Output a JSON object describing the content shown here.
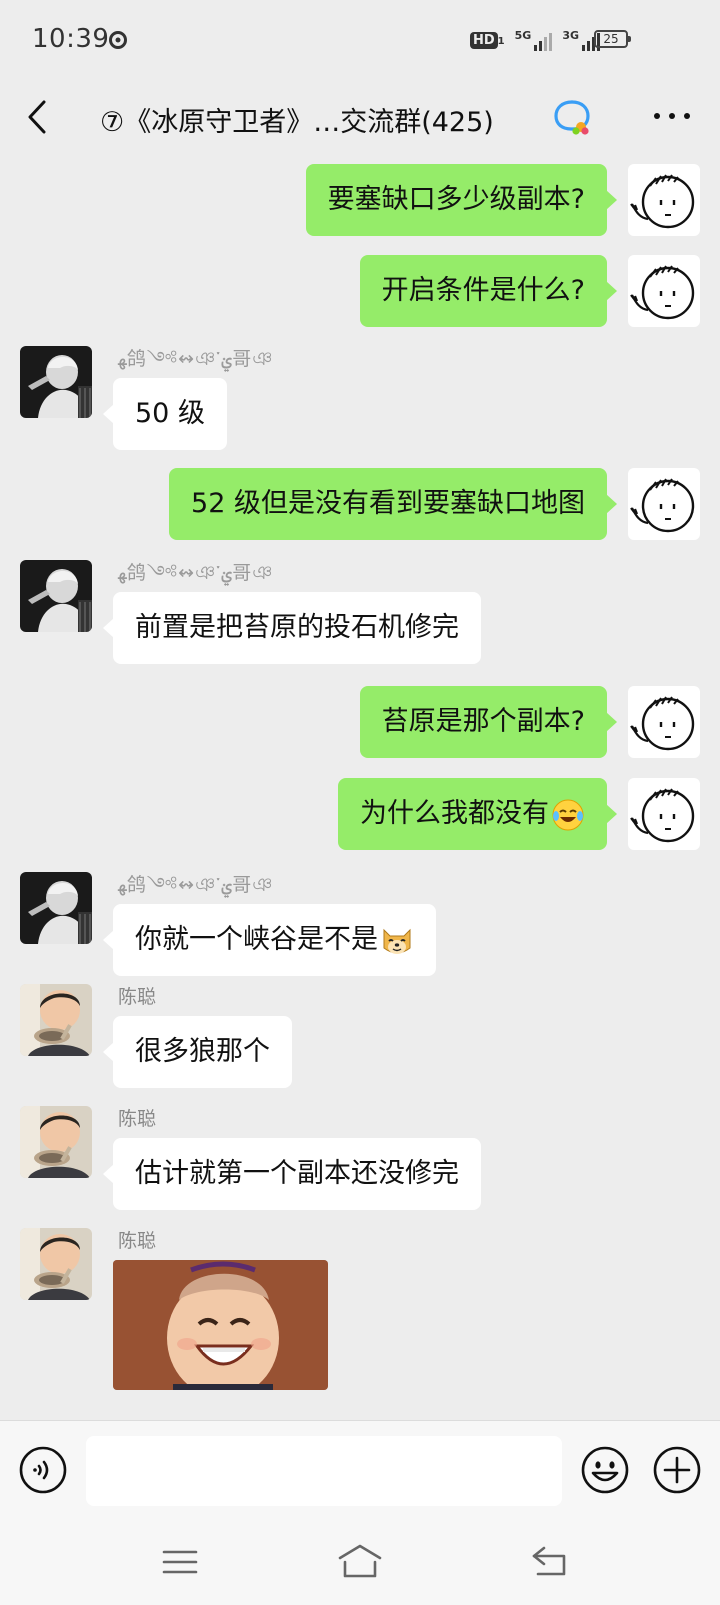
{
  "status_bar": {
    "time": "10:39",
    "hd": "HD",
    "hd_sub": "1",
    "net1": "5G",
    "net2": "3G",
    "battery": "25"
  },
  "header": {
    "title": "⑦《冰原守卫者》…交流群(425)",
    "back_icon": "chevron-left-icon",
    "more_icon": "more-dots-icon"
  },
  "messages": [
    {
      "direction": "out",
      "text": "要塞缺口多少级副本?"
    },
    {
      "direction": "out",
      "text": "开启条件是什么?"
    },
    {
      "direction": "in",
      "sender": "ﻬ鸽༺↭ঞ་ࢩ哥ঞ",
      "text": "50 级"
    },
    {
      "direction": "out",
      "text": "52 级但是没有看到要塞缺口地图"
    },
    {
      "direction": "in",
      "sender": "ﻬ鸽༺↭ঞ་ࢩ哥ঞ",
      "text": "前置是把苔原的投石机修完"
    },
    {
      "direction": "out",
      "text": "苔原是那个副本?"
    },
    {
      "direction": "out",
      "text": "为什么我都没有",
      "emoji": "crying-laughing-emoji"
    },
    {
      "direction": "in",
      "sender": "ﻬ鸽༺↭ঞ་ࢩ哥ঞ",
      "text": "你就一个峡谷是不是",
      "emoji": "doge-emoji"
    },
    {
      "direction": "in",
      "sender": "陈聪",
      "text": "很多狼那个"
    },
    {
      "direction": "in",
      "sender": "陈聪",
      "text": "估计就第一个副本还没修完"
    },
    {
      "direction": "in",
      "sender": "陈聪",
      "image": "laughing-child-sticker"
    }
  ],
  "input": {
    "placeholder": ""
  },
  "colors": {
    "background": "#ededed",
    "outgoing_bubble": "#95ec69",
    "incoming_bubble": "#ffffff"
  }
}
